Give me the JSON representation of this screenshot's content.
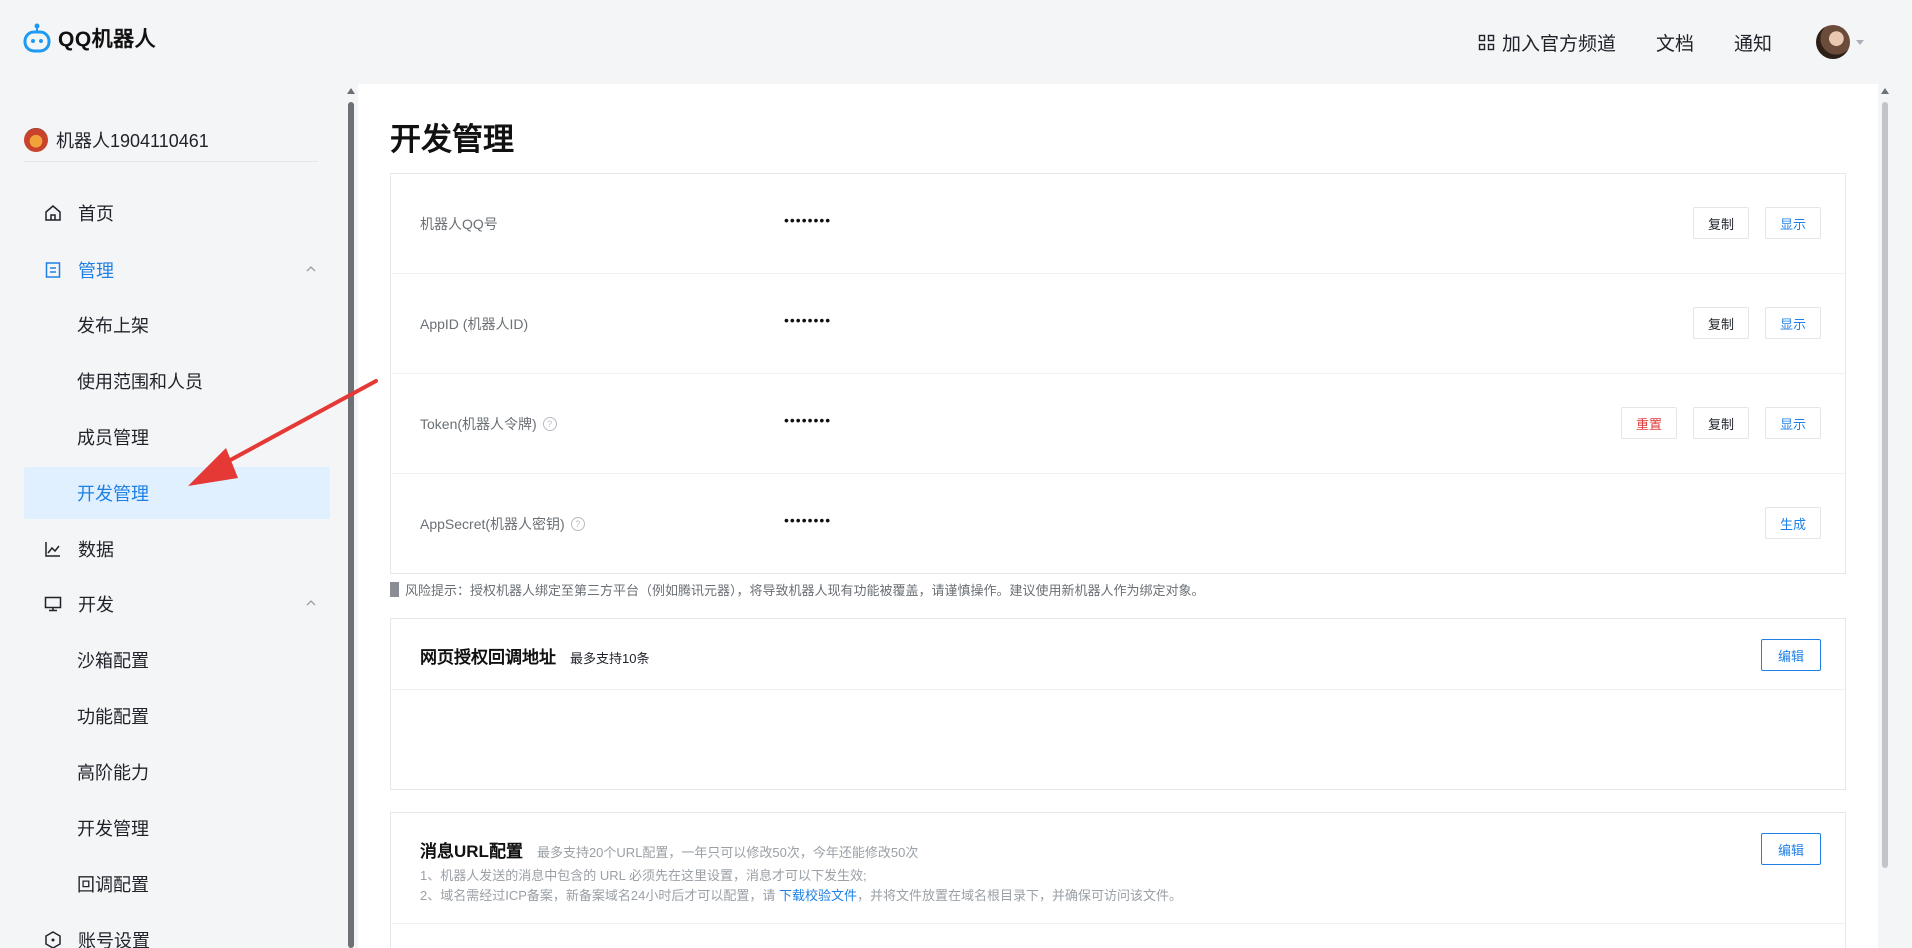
{
  "header": {
    "logo_text": "QQ机器人",
    "links": [
      {
        "label": "加入官方频道",
        "icon": "grid-icon"
      },
      {
        "label": "文档"
      },
      {
        "label": "通知"
      }
    ]
  },
  "sidebar": {
    "bot_name": "机器人1904110461",
    "items": [
      {
        "label": "首页",
        "icon": "home-icon"
      },
      {
        "label": "管理",
        "icon": "document-icon",
        "expanded": true
      },
      {
        "label": "发布上架"
      },
      {
        "label": "使用范围和人员"
      },
      {
        "label": "成员管理"
      },
      {
        "label": "开发管理",
        "active": true
      },
      {
        "label": "数据",
        "icon": "line-chart-icon"
      },
      {
        "label": "开发",
        "icon": "monitor-icon",
        "expanded": true
      },
      {
        "label": "沙箱配置"
      },
      {
        "label": "功能配置"
      },
      {
        "label": "高阶能力"
      },
      {
        "label": "开发管理"
      },
      {
        "label": "回调配置"
      },
      {
        "label": "账号设置",
        "icon": "shield-icon"
      }
    ]
  },
  "main": {
    "title": "开发管理",
    "credentials": [
      {
        "label": "机器人QQ号",
        "value": "••••••••",
        "buttons": [
          "复制",
          "显示"
        ]
      },
      {
        "label": "AppID (机器人ID)",
        "value": "••••••••",
        "buttons": [
          "复制",
          "显示"
        ]
      },
      {
        "label": "Token(机器人令牌)",
        "value": "••••••••",
        "help": "?",
        "buttons": [
          "重置",
          "复制",
          "显示"
        ]
      },
      {
        "label": "AppSecret(机器人密钥)",
        "value": "••••••••",
        "help": "?",
        "buttons": [
          "生成"
        ]
      }
    ],
    "risk_tip": "风险提示：授权机器人绑定至第三方平台（例如腾讯元器），将导致机器人现有功能被覆盖，请谨慎操作。建议使用新机器人作为绑定对象。",
    "web_callback": {
      "title": "网页授权回调地址",
      "subtitle": "最多支持10条",
      "edit_label": "编辑"
    },
    "message_url": {
      "title": "消息URL配置",
      "subtitle": "最多支持20个URL配置，一年只可以修改50次，今年还能修改50次",
      "note1": "1、机器人发送的消息中包含的 URL 必须先在这里设置，消息才可以下发生效;",
      "note2_prefix": "2、域名需经过ICP备案，新备案域名24小时后才可以配置，请 ",
      "note2_link": "下载校验文件",
      "note2_suffix": "，并将文件放置在域名根目录下，并确保可访问该文件。",
      "edit_label": "编辑"
    }
  },
  "colors": {
    "accent": "#1e80e6",
    "danger": "#e03a3a",
    "active_bg": "#e0f0ff",
    "annotation": "#e53935"
  }
}
